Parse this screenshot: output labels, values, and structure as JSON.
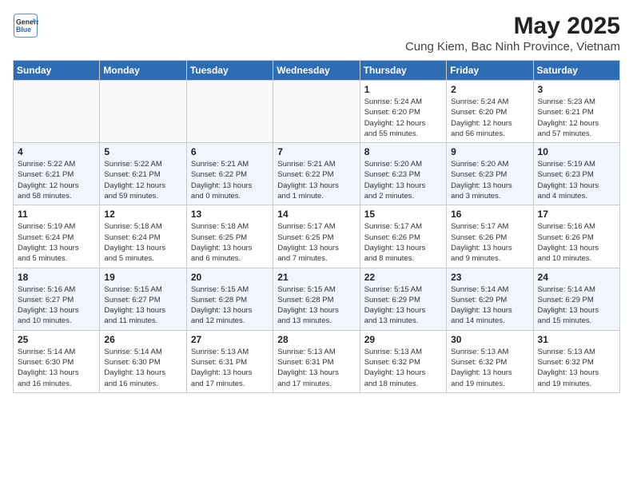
{
  "logo": {
    "line1": "General",
    "line2": "Blue"
  },
  "title": "May 2025",
  "subtitle": "Cung Kiem, Bac Ninh Province, Vietnam",
  "weekdays": [
    "Sunday",
    "Monday",
    "Tuesday",
    "Wednesday",
    "Thursday",
    "Friday",
    "Saturday"
  ],
  "weeks": [
    [
      {
        "day": "",
        "info": ""
      },
      {
        "day": "",
        "info": ""
      },
      {
        "day": "",
        "info": ""
      },
      {
        "day": "",
        "info": ""
      },
      {
        "day": "1",
        "info": "Sunrise: 5:24 AM\nSunset: 6:20 PM\nDaylight: 12 hours\nand 55 minutes."
      },
      {
        "day": "2",
        "info": "Sunrise: 5:24 AM\nSunset: 6:20 PM\nDaylight: 12 hours\nand 56 minutes."
      },
      {
        "day": "3",
        "info": "Sunrise: 5:23 AM\nSunset: 6:21 PM\nDaylight: 12 hours\nand 57 minutes."
      }
    ],
    [
      {
        "day": "4",
        "info": "Sunrise: 5:22 AM\nSunset: 6:21 PM\nDaylight: 12 hours\nand 58 minutes."
      },
      {
        "day": "5",
        "info": "Sunrise: 5:22 AM\nSunset: 6:21 PM\nDaylight: 12 hours\nand 59 minutes."
      },
      {
        "day": "6",
        "info": "Sunrise: 5:21 AM\nSunset: 6:22 PM\nDaylight: 13 hours\nand 0 minutes."
      },
      {
        "day": "7",
        "info": "Sunrise: 5:21 AM\nSunset: 6:22 PM\nDaylight: 13 hours\nand 1 minute."
      },
      {
        "day": "8",
        "info": "Sunrise: 5:20 AM\nSunset: 6:23 PM\nDaylight: 13 hours\nand 2 minutes."
      },
      {
        "day": "9",
        "info": "Sunrise: 5:20 AM\nSunset: 6:23 PM\nDaylight: 13 hours\nand 3 minutes."
      },
      {
        "day": "10",
        "info": "Sunrise: 5:19 AM\nSunset: 6:23 PM\nDaylight: 13 hours\nand 4 minutes."
      }
    ],
    [
      {
        "day": "11",
        "info": "Sunrise: 5:19 AM\nSunset: 6:24 PM\nDaylight: 13 hours\nand 5 minutes."
      },
      {
        "day": "12",
        "info": "Sunrise: 5:18 AM\nSunset: 6:24 PM\nDaylight: 13 hours\nand 5 minutes."
      },
      {
        "day": "13",
        "info": "Sunrise: 5:18 AM\nSunset: 6:25 PM\nDaylight: 13 hours\nand 6 minutes."
      },
      {
        "day": "14",
        "info": "Sunrise: 5:17 AM\nSunset: 6:25 PM\nDaylight: 13 hours\nand 7 minutes."
      },
      {
        "day": "15",
        "info": "Sunrise: 5:17 AM\nSunset: 6:26 PM\nDaylight: 13 hours\nand 8 minutes."
      },
      {
        "day": "16",
        "info": "Sunrise: 5:17 AM\nSunset: 6:26 PM\nDaylight: 13 hours\nand 9 minutes."
      },
      {
        "day": "17",
        "info": "Sunrise: 5:16 AM\nSunset: 6:26 PM\nDaylight: 13 hours\nand 10 minutes."
      }
    ],
    [
      {
        "day": "18",
        "info": "Sunrise: 5:16 AM\nSunset: 6:27 PM\nDaylight: 13 hours\nand 10 minutes."
      },
      {
        "day": "19",
        "info": "Sunrise: 5:15 AM\nSunset: 6:27 PM\nDaylight: 13 hours\nand 11 minutes."
      },
      {
        "day": "20",
        "info": "Sunrise: 5:15 AM\nSunset: 6:28 PM\nDaylight: 13 hours\nand 12 minutes."
      },
      {
        "day": "21",
        "info": "Sunrise: 5:15 AM\nSunset: 6:28 PM\nDaylight: 13 hours\nand 13 minutes."
      },
      {
        "day": "22",
        "info": "Sunrise: 5:15 AM\nSunset: 6:29 PM\nDaylight: 13 hours\nand 13 minutes."
      },
      {
        "day": "23",
        "info": "Sunrise: 5:14 AM\nSunset: 6:29 PM\nDaylight: 13 hours\nand 14 minutes."
      },
      {
        "day": "24",
        "info": "Sunrise: 5:14 AM\nSunset: 6:29 PM\nDaylight: 13 hours\nand 15 minutes."
      }
    ],
    [
      {
        "day": "25",
        "info": "Sunrise: 5:14 AM\nSunset: 6:30 PM\nDaylight: 13 hours\nand 16 minutes."
      },
      {
        "day": "26",
        "info": "Sunrise: 5:14 AM\nSunset: 6:30 PM\nDaylight: 13 hours\nand 16 minutes."
      },
      {
        "day": "27",
        "info": "Sunrise: 5:13 AM\nSunset: 6:31 PM\nDaylight: 13 hours\nand 17 minutes."
      },
      {
        "day": "28",
        "info": "Sunrise: 5:13 AM\nSunset: 6:31 PM\nDaylight: 13 hours\nand 17 minutes."
      },
      {
        "day": "29",
        "info": "Sunrise: 5:13 AM\nSunset: 6:32 PM\nDaylight: 13 hours\nand 18 minutes."
      },
      {
        "day": "30",
        "info": "Sunrise: 5:13 AM\nSunset: 6:32 PM\nDaylight: 13 hours\nand 19 minutes."
      },
      {
        "day": "31",
        "info": "Sunrise: 5:13 AM\nSunset: 6:32 PM\nDaylight: 13 hours\nand 19 minutes."
      }
    ]
  ]
}
